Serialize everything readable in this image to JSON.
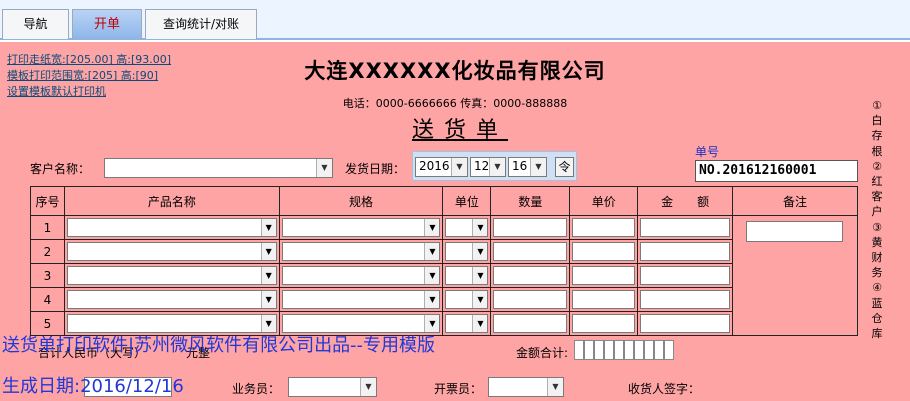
{
  "tabs": [
    {
      "label": "导航"
    },
    {
      "label": "开单"
    },
    {
      "label": "查询统计/对账"
    }
  ],
  "print_links": {
    "paper_size": "打印走纸宽:[205.00] 高:[93.00]",
    "template_range": "模板打印范围宽:[205] 高:[90]",
    "set_default_printer": "设置模板默认打印机"
  },
  "header": {
    "company": "大连XXXXXX化妆品有限公司",
    "contact": "电话：0000-6666666  传真：0000-888888",
    "title": "送货单"
  },
  "form": {
    "customer_label": "客户名称：",
    "customer_value": "",
    "ship_date_label": "发货日期：",
    "date_year": "2016",
    "date_month": "12",
    "date_day": "16",
    "date_button_icon": "lock-icon",
    "docno_label": "单号",
    "docno_value": "NO.201612160001"
  },
  "table": {
    "columns": [
      "序号",
      "产品名称",
      "规格",
      "单位",
      "数量",
      "单价",
      "金　　额",
      "备注"
    ],
    "rows": [
      "1",
      "2",
      "3",
      "4",
      "5"
    ]
  },
  "side_text": "①白存根②红客户③黄财务④蓝仓库",
  "footer": {
    "total_label": "合计人民币（大写）",
    "total_suffix": "元整",
    "amount_total_label": "金额合计:",
    "salesman_label": "业务员：",
    "invoicer_label": "开票员：",
    "receiver_label": "收货人签字："
  },
  "overlay": {
    "line1": "送货单打印软件|苏州微风软件有限公司出品--专用模版",
    "line2": "生成日期:2016/12/16"
  },
  "colors": {
    "form_bg": "#ffa4a4",
    "tab_active_text": "#c00000",
    "overlay_text": "#2038d8"
  }
}
